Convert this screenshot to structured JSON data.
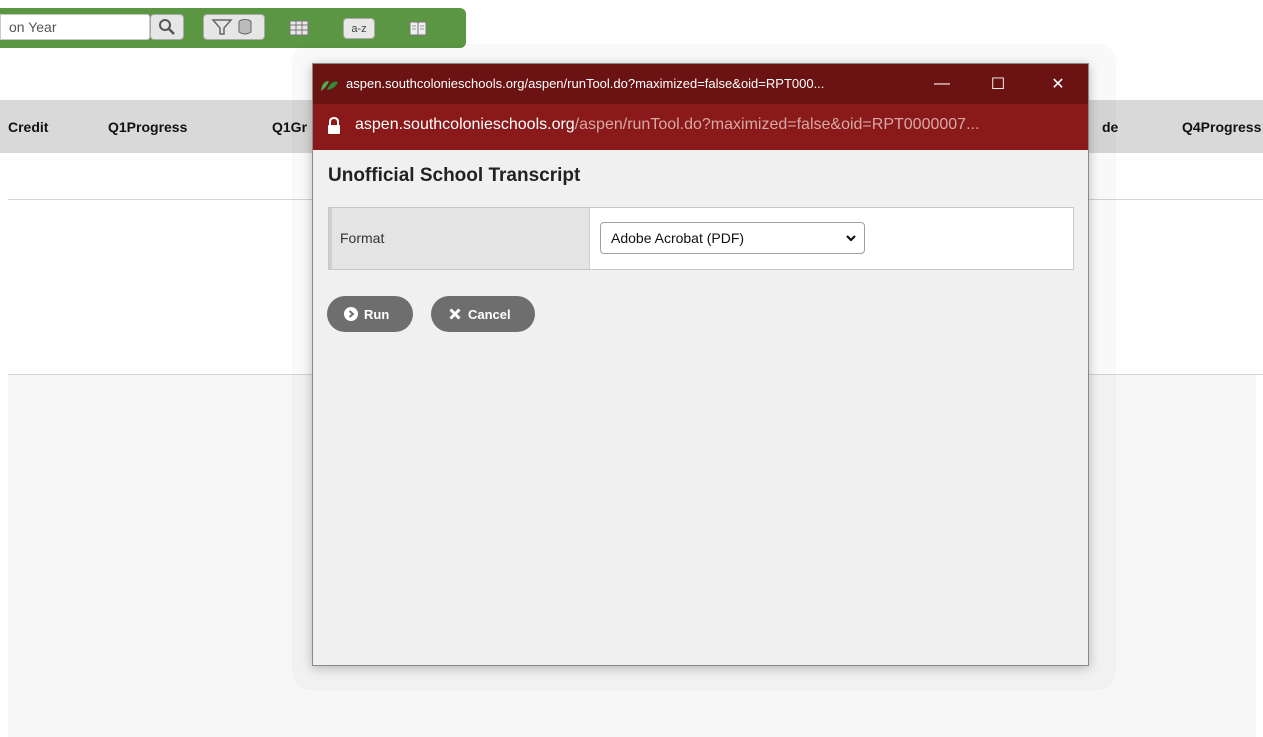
{
  "toolbar": {
    "search_value": "on Year",
    "icons": [
      "search-icon",
      "filter-icon",
      "grid-icon",
      "sort-az-icon",
      "book-icon"
    ],
    "sort_label": "a-z"
  },
  "table": {
    "columns": [
      "Credit",
      "Q1Progress",
      "Q1Gr",
      "de",
      "Q4Progress"
    ]
  },
  "popup": {
    "window_title": "aspen.southcolonieschools.org/aspen/runTool.do?maximized=false&oid=RPT000...",
    "url_domain": "aspen.southcolonieschools.org",
    "url_path": "/aspen/runTool.do?maximized=false&oid=RPT0000007...",
    "minimize": "—",
    "maximize": "☐",
    "close": "✕",
    "dialog_title": "Unofficial School Transcript",
    "form": {
      "format_label": "Format",
      "format_value": "Adobe Acrobat (PDF)"
    },
    "buttons": {
      "run": "Run",
      "cancel": "Cancel"
    }
  },
  "colors": {
    "toolbar_green": "#5b9642",
    "titlebar": "#6b1212",
    "addressbar": "#8a1a1a",
    "pill_button": "#6e6e6e"
  }
}
